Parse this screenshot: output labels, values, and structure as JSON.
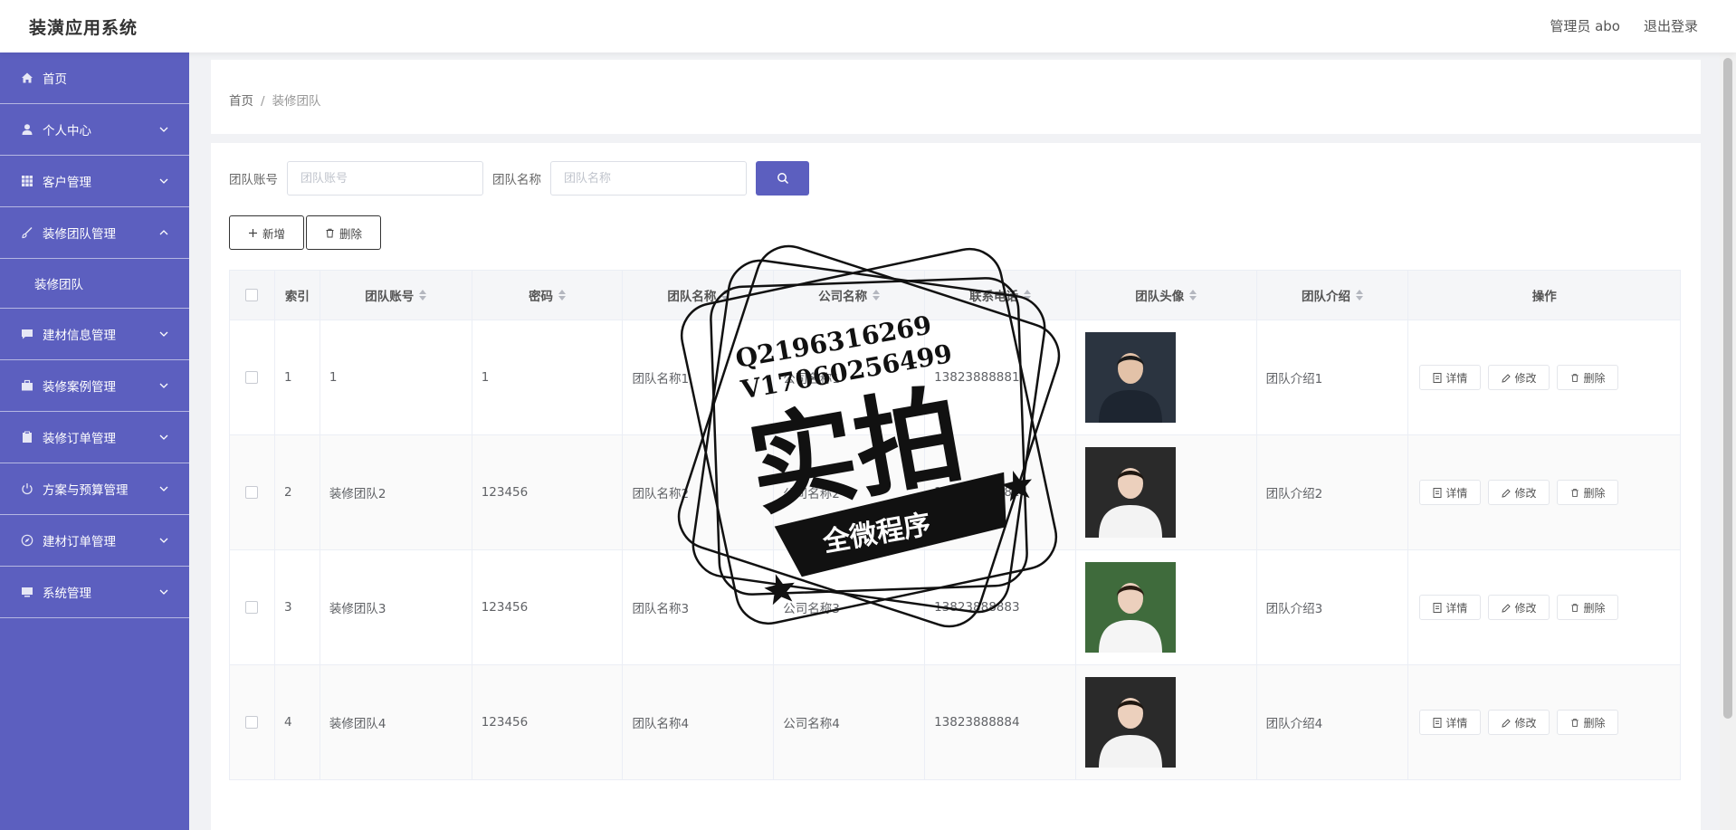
{
  "header": {
    "brand": "装潢应用系统",
    "admin": "管理员 abo",
    "logout": "退出登录"
  },
  "sidebar": {
    "items": [
      {
        "label": "首页",
        "icon": "home-icon"
      },
      {
        "label": "个人中心",
        "icon": "user-icon"
      },
      {
        "label": "客户管理",
        "icon": "grid-icon"
      },
      {
        "label": "装修团队管理",
        "icon": "brush-icon",
        "expanded": true
      },
      {
        "label": "装修团队",
        "sub": true
      },
      {
        "label": "建材信息管理",
        "icon": "chat-icon"
      },
      {
        "label": "装修案例管理",
        "icon": "briefcase-icon"
      },
      {
        "label": "装修订单管理",
        "icon": "clipboard-icon"
      },
      {
        "label": "方案与预算管理",
        "icon": "power-icon"
      },
      {
        "label": "建材订单管理",
        "icon": "compass-icon"
      },
      {
        "label": "系统管理",
        "icon": "monitor-icon"
      }
    ]
  },
  "breadcrumb": {
    "home": "首页",
    "separator": "/",
    "current": "装修团队"
  },
  "search": {
    "account_label": "团队账号",
    "account_placeholder": "团队账号",
    "name_label": "团队名称",
    "name_placeholder": "团队名称"
  },
  "toolbar": {
    "add": "新增",
    "delete": "删除"
  },
  "table": {
    "columns": [
      "索引",
      "团队账号",
      "密码",
      "团队名称",
      "公司名称",
      "联系电话",
      "团队头像",
      "团队介绍",
      "操作"
    ],
    "actions": {
      "detail": "详情",
      "edit": "修改",
      "delete": "删除"
    },
    "rows": [
      {
        "idx": "1",
        "account": "1",
        "password": "1",
        "team": "团队名称1",
        "company": "公司名称1",
        "phone": "13823888881",
        "intro": "团队介绍1"
      },
      {
        "idx": "2",
        "account": "装修团队2",
        "password": "123456",
        "team": "团队名称2",
        "company": "公司名称2",
        "phone": "13823888882",
        "intro": "团队介绍2"
      },
      {
        "idx": "3",
        "account": "装修团队3",
        "password": "123456",
        "team": "团队名称3",
        "company": "公司名称3",
        "phone": "13823888883",
        "intro": "团队介绍3"
      },
      {
        "idx": "4",
        "account": "装修团队4",
        "password": "123456",
        "team": "团队名称4",
        "company": "公司名称4",
        "phone": "13823888884",
        "intro": "团队介绍4"
      }
    ]
  },
  "watermark": {
    "line1": "Q2196316269",
    "line2": "V17060256499",
    "big": "实拍",
    "ribbon": "全微程序"
  },
  "colors": {
    "accent": "#5c5fbf",
    "sidebar_bg": "#5c5fbf"
  }
}
